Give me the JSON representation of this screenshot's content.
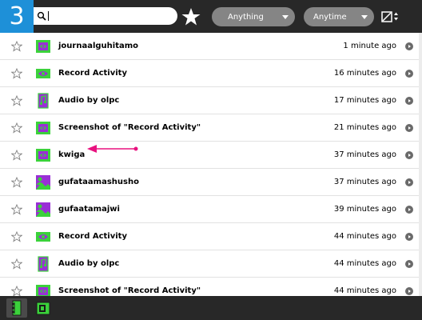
{
  "tutorial": {
    "step": "3"
  },
  "toolbar": {
    "search": {
      "value": "",
      "placeholder": ""
    },
    "favorites_filter_icon": "star-icon",
    "what_filter": "Anything",
    "when_filter": "Anytime",
    "sort_icon": "sort-icon"
  },
  "entries": [
    {
      "title": "journaalguhitamo",
      "time": "1 minute ago",
      "icon": "activity-write-icon",
      "favorite": false
    },
    {
      "title": "Record Activity",
      "time": "16 minutes ago",
      "icon": "record-activity-icon",
      "favorite": false
    },
    {
      "title": "Audio by olpc",
      "time": "17 minutes ago",
      "icon": "audio-icon",
      "favorite": false
    },
    {
      "title": "Screenshot of \"Record Activity\"",
      "time": "21 minutes ago",
      "icon": "screenshot-icon",
      "favorite": false
    },
    {
      "title": "kwiga",
      "time": "37 minutes ago",
      "icon": "activity-write-icon",
      "favorite": false
    },
    {
      "title": "gufataamashusho",
      "time": "37 minutes ago",
      "icon": "image-icon",
      "favorite": false
    },
    {
      "title": "gufaatamajwi",
      "time": "39 minutes ago",
      "icon": "image-icon",
      "favorite": false
    },
    {
      "title": "Record Activity",
      "time": "44 minutes ago",
      "icon": "record-activity-icon",
      "favorite": false
    },
    {
      "title": "Audio by olpc",
      "time": "44 minutes ago",
      "icon": "audio-icon",
      "favorite": false
    },
    {
      "title": "Screenshot of \"Record Activity\"",
      "time": "44 minutes ago",
      "icon": "screenshot-icon",
      "favorite": false
    }
  ],
  "annotation": {
    "color": "#e8117f"
  },
  "colors": {
    "toolbar": "#282828",
    "accent_green": "#3bd23b",
    "accent_purple": "#9a2fd6",
    "badge": "#1e90d8"
  },
  "bottombar": {
    "volumes": [
      "journal-volume-icon",
      "documents-volume-icon"
    ]
  }
}
